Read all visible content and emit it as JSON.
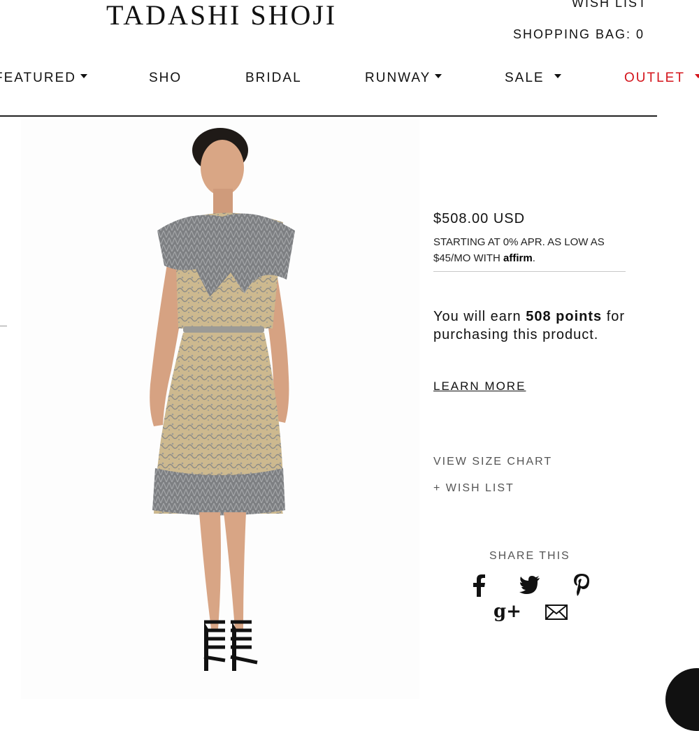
{
  "header": {
    "logo": "TADASHI SHOJI",
    "wish_list": "WISH LIST",
    "shopping_bag": "SHOPPING BAG: 0"
  },
  "nav": {
    "featured": "FEATURED",
    "shop": "SHO",
    "bridal": "BRIDAL",
    "runway": "RUNWAY",
    "sale": "SALE",
    "outlet": "OUTLET",
    "outlet_color": "#d4141b"
  },
  "product": {
    "price": "$508.00 USD",
    "financing_text": "STARTING AT 0% APR. AS LOW AS $45/MO WITH",
    "affirm_label": "affirm",
    "financing_end": ".",
    "points_pre": "You will earn",
    "points_value": "508 points",
    "points_post": "for purchasing this product.",
    "learn_more": "LEARN MORE",
    "size_chart": "VIEW SIZE CHART",
    "wish_list_add": "+ WISH LIST"
  },
  "share": {
    "title": "SHARE THIS",
    "icons": [
      "facebook-icon",
      "twitter-icon",
      "pinterest-icon",
      "google-plus-icon",
      "email-icon"
    ]
  }
}
